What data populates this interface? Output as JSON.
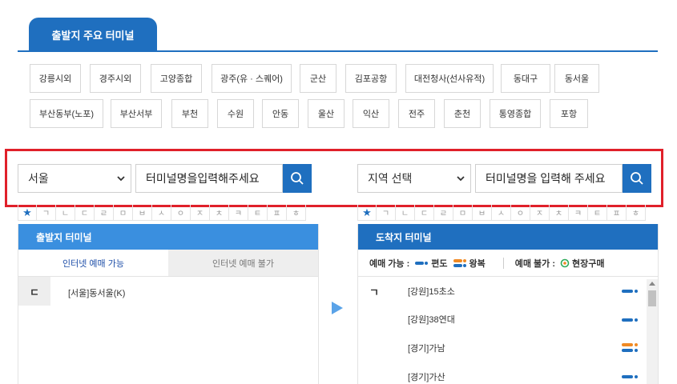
{
  "header": {
    "tab_label": "출발지 주요 터미널"
  },
  "major_terminals": [
    "강릉시외",
    "경주시외",
    "고양종합",
    "광주(유 · 스퀘어)",
    "군산",
    "김포공항",
    "대전청사(선사유적)",
    "동대구",
    "동서울",
    "부산동부(노포)",
    "부산서부",
    "부천",
    "수원",
    "안동",
    "울산",
    "익산",
    "전주",
    "춘천",
    "통영종합",
    "포항"
  ],
  "departure": {
    "region": "서울",
    "placeholder": "터미널명을입력해주세요",
    "panel_title": "출발지 터미널",
    "tab_available": "인터넷 예매 가능",
    "tab_unavailable": "인터넷 예매 불가",
    "initial": "ㄷ",
    "terminals": [
      "[서울]동서울(K)"
    ]
  },
  "arrival": {
    "region": "지역 선택",
    "placeholder": "터미널명을 입력해 주세요",
    "panel_title": "도착지 터미널",
    "legend": {
      "available_label": "예매 가능 :",
      "oneway_label": "편도",
      "roundtrip_label": "왕복",
      "unavailable_label": "예매 불가 :",
      "onsite_label": "현장구매"
    },
    "initial": "ㄱ",
    "terminals": [
      {
        "name": "[강원]15초소",
        "type": "oneway"
      },
      {
        "name": "[강원]38연대",
        "type": "oneway"
      },
      {
        "name": "[경기]가남",
        "type": "roundtrip"
      },
      {
        "name": "[경기]가산",
        "type": "oneway"
      }
    ]
  },
  "index_keys": [
    "★",
    "ㄱ",
    "ㄴ",
    "ㄷ",
    "ㄹ",
    "ㅁ",
    "ㅂ",
    "ㅅ",
    "ㅇ",
    "ㅈ",
    "ㅊ",
    "ㅋ",
    "ㅌ",
    "ㅍ",
    "ㅎ"
  ],
  "colors": {
    "primary": "#1f6fbf",
    "light_blue": "#3a8fdf",
    "highlight_red": "#e0202a",
    "orange": "#f08a24",
    "green": "#2faa5a"
  }
}
